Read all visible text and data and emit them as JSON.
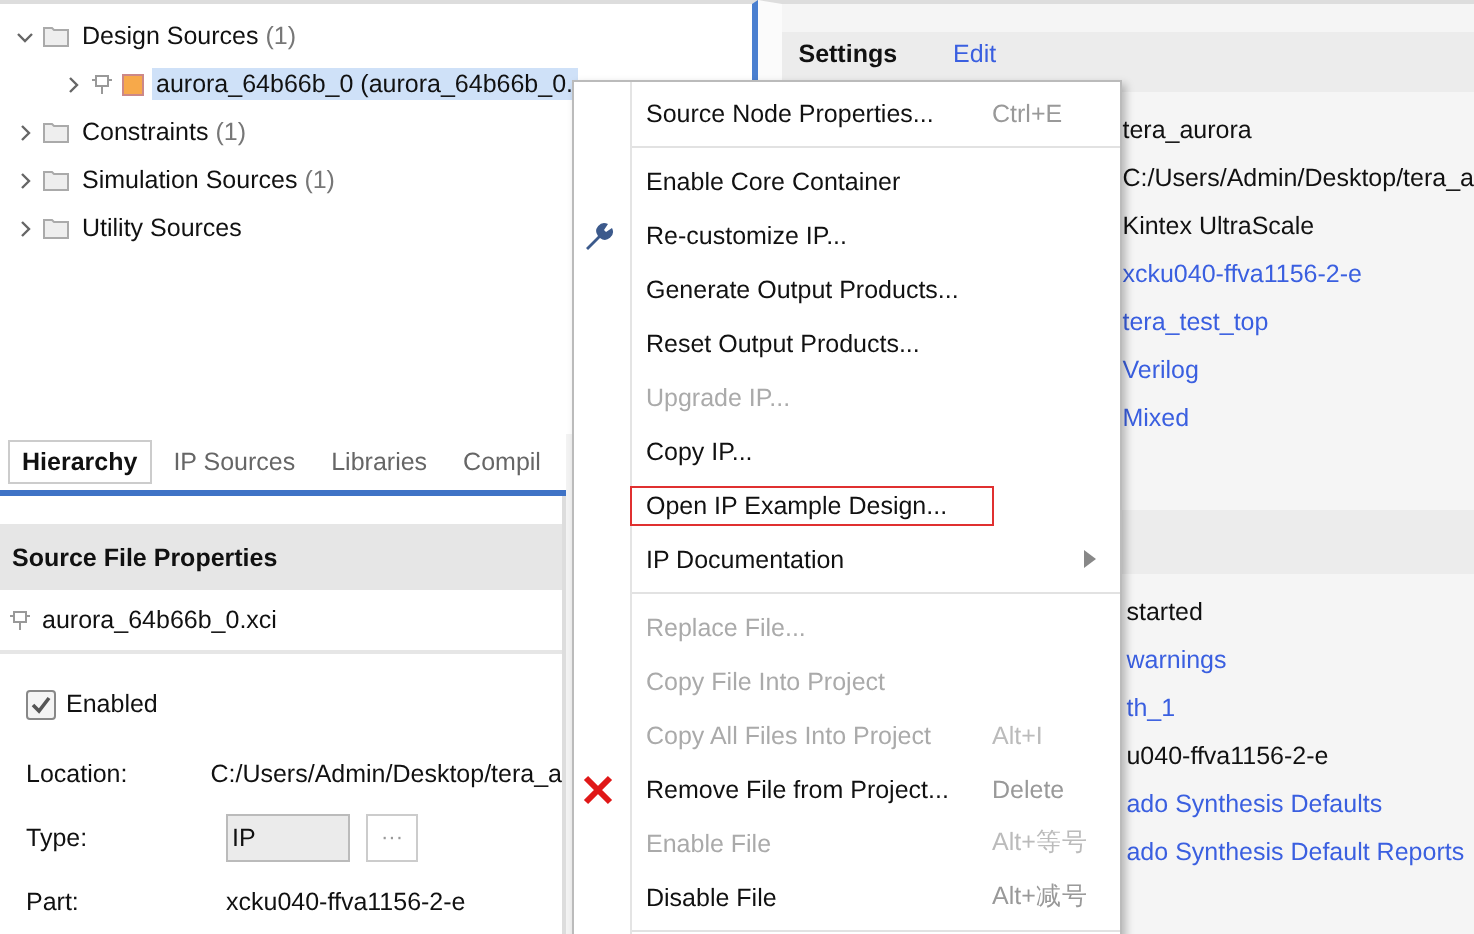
{
  "tree": [
    {
      "label": "Design Sources",
      "count": "(1)",
      "expanded": true,
      "selected": false,
      "children": [
        {
          "label": "aurora_64b66b_0 (aurora_64b66b_0.",
          "expanded": false,
          "selected": true
        }
      ]
    },
    {
      "label": "Constraints",
      "count": "(1)",
      "expanded": false,
      "selected": false
    },
    {
      "label": "Simulation Sources",
      "count": "(1)",
      "expanded": false,
      "selected": false
    },
    {
      "label": "Utility Sources",
      "expanded": false,
      "selected": false
    }
  ],
  "tabs": [
    {
      "label": "Hierarchy",
      "selected": true
    },
    {
      "label": "IP Sources",
      "selected": false
    },
    {
      "label": "Libraries",
      "selected": false
    },
    {
      "label": "Compil",
      "selected": false
    }
  ],
  "source_file_properties": {
    "title": "Source File Properties",
    "file": "aurora_64b66b_0.xci",
    "enabled": {
      "label": "Enabled",
      "checked": true
    },
    "rows": [
      {
        "label": "Location:",
        "value": "C:/Users/Admin/Desktop/tera_a",
        "kind": "text"
      },
      {
        "label": "Type:",
        "value": "IP",
        "kind": "field",
        "button": "···"
      },
      {
        "label": "Part:",
        "value": "xcku040-ffva1156-2-e",
        "kind": "text"
      }
    ]
  },
  "settings": {
    "title": "Settings",
    "action": "Edit",
    "values": [
      {
        "text": "tera_aurora",
        "kind": "text"
      },
      {
        "text": "C:/Users/Admin/Desktop/tera_a",
        "kind": "text"
      },
      {
        "text": "Kintex UltraScale",
        "kind": "text"
      },
      {
        "text": "xcku040-ffva1156-2-e",
        "kind": "link"
      },
      {
        "text": "tera_test_top",
        "kind": "link"
      },
      {
        "text": "Verilog",
        "kind": "link"
      },
      {
        "text": "Mixed",
        "kind": "link"
      }
    ]
  },
  "synthesis": {
    "values": [
      {
        "text": "started",
        "kind": "text"
      },
      {
        "text": "warnings",
        "kind": "link"
      },
      {
        "text": "th_1",
        "kind": "link"
      },
      {
        "text": "u040-ffva1156-2-e",
        "kind": "text"
      },
      {
        "text": "ado Synthesis Defaults",
        "kind": "link"
      },
      {
        "text": "ado Synthesis Default Reports",
        "kind": "link"
      }
    ]
  },
  "context_menu": [
    {
      "kind": "item",
      "label": "Source Node Properties...",
      "shortcut": "Ctrl+E",
      "disabled": false,
      "outlined": false,
      "submenu": false
    },
    {
      "kind": "separator"
    },
    {
      "kind": "item",
      "label": "Enable Core Container",
      "disabled": false,
      "outlined": false,
      "submenu": false
    },
    {
      "kind": "tool-item",
      "label": "Re-customize IP...",
      "disabled": false,
      "outlined": false,
      "submenu": false
    },
    {
      "kind": "item",
      "label": "Generate Output Products...",
      "disabled": false,
      "outlined": false,
      "submenu": false
    },
    {
      "kind": "item",
      "label": "Reset Output Products...",
      "disabled": false,
      "outlined": false,
      "submenu": false
    },
    {
      "kind": "item",
      "label": "Upgrade IP...",
      "disabled": true,
      "outlined": false,
      "submenu": false
    },
    {
      "kind": "item",
      "label": "Copy IP...",
      "disabled": false,
      "outlined": false,
      "submenu": false
    },
    {
      "kind": "item",
      "label": "Open IP Example Design...",
      "disabled": false,
      "outlined": true,
      "submenu": false
    },
    {
      "kind": "item",
      "label": "IP Documentation",
      "disabled": false,
      "outlined": false,
      "submenu": true
    },
    {
      "kind": "separator"
    },
    {
      "kind": "item",
      "label": "Replace File...",
      "disabled": true,
      "outlined": false,
      "submenu": false
    },
    {
      "kind": "item",
      "label": "Copy File Into Project",
      "disabled": true,
      "outlined": false,
      "submenu": false
    },
    {
      "kind": "item",
      "label": "Copy All Files Into Project",
      "shortcut": "Alt+I",
      "disabled": true,
      "outlined": false,
      "submenu": false
    },
    {
      "kind": "remove-item",
      "label": "Remove File from Project...",
      "shortcut": "Delete",
      "disabled": false,
      "outlined": false,
      "submenu": false
    },
    {
      "kind": "item",
      "label": "Enable File",
      "shortcut": "Alt+等号",
      "disabled": true,
      "outlined": false,
      "submenu": false
    },
    {
      "kind": "item",
      "label": "Disable File",
      "shortcut": "Alt+减号",
      "disabled": false,
      "outlined": false,
      "submenu": false
    },
    {
      "kind": "separator"
    }
  ]
}
